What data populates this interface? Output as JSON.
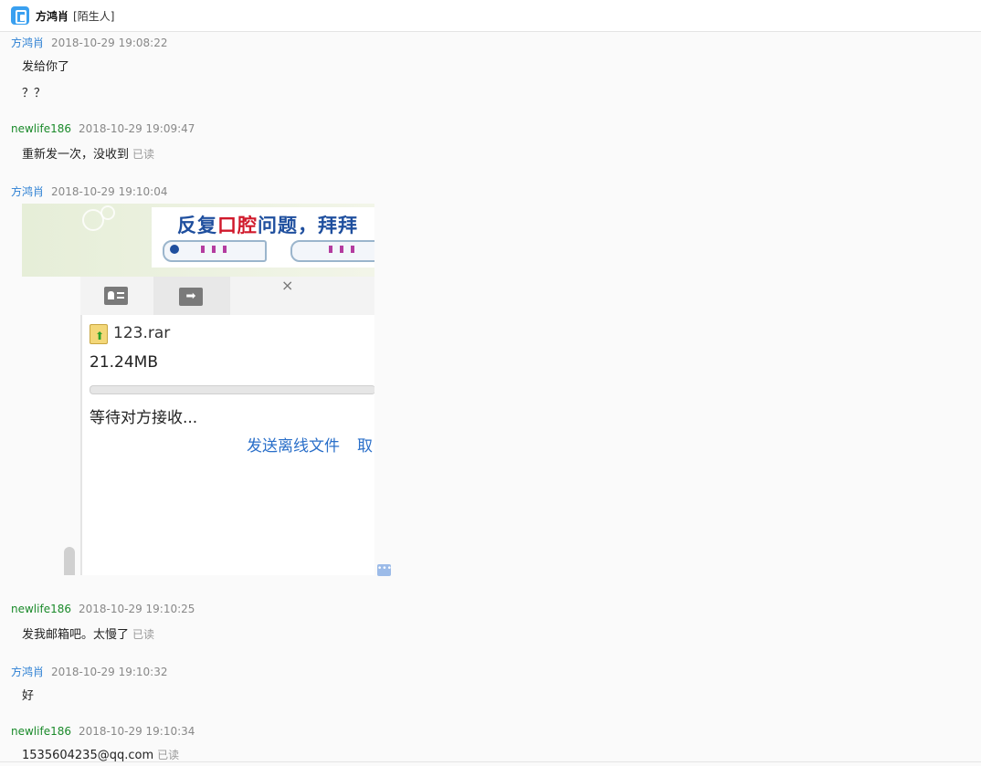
{
  "header": {
    "contact_name": "方鸿肖",
    "contact_tag": "[陌生人]"
  },
  "messages": [
    {
      "sender": "方鸿肖",
      "time": "2018-10-29 19:08:22",
      "lines": [
        "发给你了",
        "？？"
      ]
    },
    {
      "sender": "newlife186",
      "time": "2018-10-29 19:09:47",
      "text": "重新发一次，没收到",
      "status": "已读"
    },
    {
      "sender": "方鸿肖",
      "time": "2018-10-29 19:10:04",
      "image": true
    },
    {
      "sender": "newlife186",
      "time": "2018-10-29 19:10:25",
      "text": "发我邮箱吧。太慢了",
      "status": "已读"
    },
    {
      "sender": "方鸿肖",
      "time": "2018-10-29 19:10:32",
      "text": "好"
    },
    {
      "sender": "newlife186",
      "time": "2018-10-29 19:10:34",
      "text": "1535604235@qq.com",
      "status": "已读"
    }
  ],
  "screenshot": {
    "ad_text_blue": "反复",
    "ad_text_red": "口腔",
    "ad_text_blue2": "问题，拜拜",
    "file_name": "123.rar",
    "file_size": "21.24MB",
    "status": "等待对方接收...",
    "send_offline": "发送离线文件",
    "cancel_partial": "取",
    "close_glyph": "×",
    "folder_glyph": "➡",
    "progress_fraction": 0
  },
  "more_glyph": "•••",
  "icons": [
    "app-icon",
    "contact-card-icon",
    "folder-send-icon",
    "close-icon",
    "file-upload-icon",
    "more-icon"
  ],
  "colors": {
    "sender_self": "#2b7fd3",
    "sender_other": "#1a8a2a",
    "link": "#2a6fc9"
  }
}
